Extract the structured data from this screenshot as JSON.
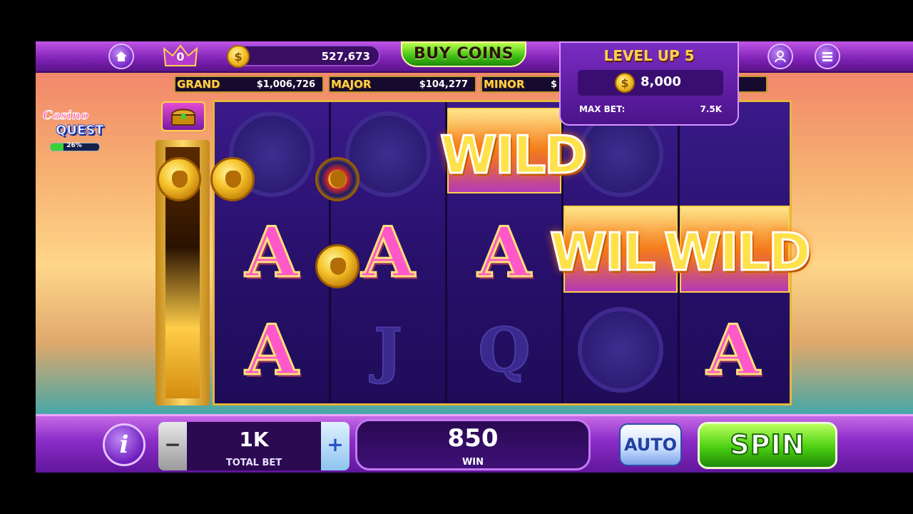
{
  "topbar": {
    "home_icon": "home-icon",
    "crown_count": "0",
    "coin_balance": "527,673",
    "buy_coins_label": "BUY COINS",
    "profile_icon": "profile-icon",
    "menu_icon": "menu-icon"
  },
  "jackpots": [
    {
      "name": "GRAND",
      "value": "$1,006,726"
    },
    {
      "name": "MAJOR",
      "value": "$104,277"
    },
    {
      "name": "MINOR",
      "value": "$"
    }
  ],
  "level_up": {
    "title": "LEVEL UP 5",
    "reward": "8,000",
    "max_bet_label": "MAX BET:",
    "max_bet_value": "7.5K"
  },
  "casino_quest": {
    "line1": "Casino",
    "line2": "QUEST",
    "progress_label": "26%",
    "progress": 0.26
  },
  "reels": {
    "wild_label": "WILD",
    "wild_partial_label": "WIL",
    "symbols": {
      "a": "A",
      "j": "J",
      "q": "Q"
    }
  },
  "bottombar": {
    "info_label": "i",
    "minus_label": "−",
    "plus_label": "+",
    "total_bet_value": "1K",
    "total_bet_label": "TOTAL BET",
    "win_value": "850",
    "win_label": "WIN",
    "auto_label": "AUTO",
    "spin_label": "SPIN"
  },
  "colors": {
    "accent_purple": "#7d21b4",
    "spin_green": "#4bcf12",
    "gold": "#ffd24a",
    "symbol_pink": "#ff58c8"
  }
}
